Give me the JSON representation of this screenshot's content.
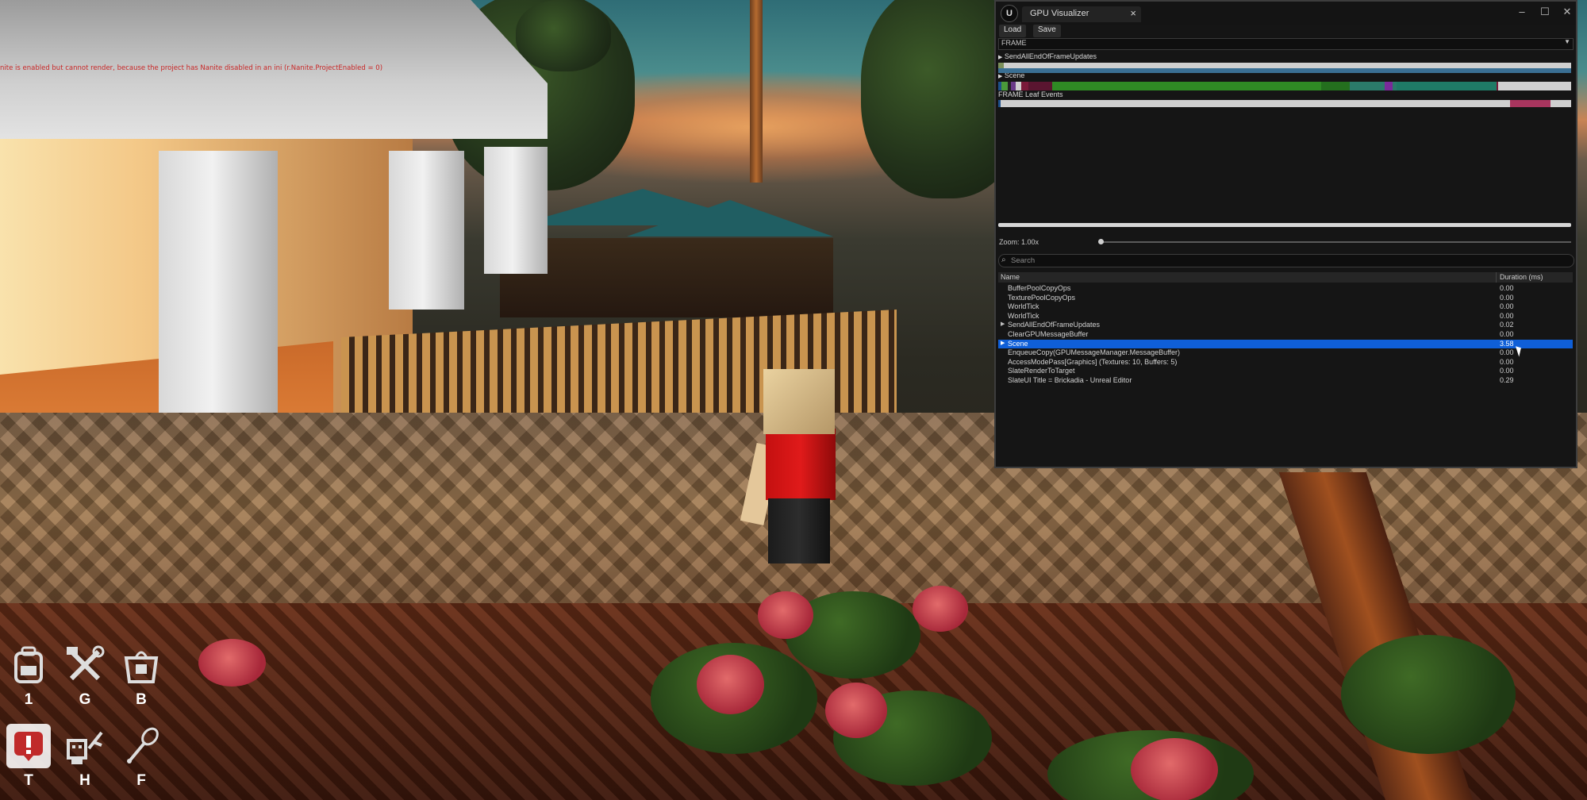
{
  "game": {
    "warning_text": "nite is enabled but cannot render, because the project has Nanite disabled in an ini (r.Nanite.ProjectEnabled = 0)",
    "hotbar": [
      {
        "icon": "backpack-icon",
        "key": "1"
      },
      {
        "icon": "hammer-wrench-icon",
        "key": "G"
      },
      {
        "icon": "brick-bag-icon",
        "key": "B"
      },
      {
        "icon": "alert-icon",
        "key": "T",
        "selected": true
      },
      {
        "icon": "build-worker-icon",
        "key": "H"
      },
      {
        "icon": "pen-icon",
        "key": "F"
      }
    ]
  },
  "window": {
    "tab_title": "GPU Visualizer",
    "toolbar": {
      "load": "Load",
      "save": "Save"
    },
    "frame_selector": "FRAME",
    "timeline": {
      "rows": [
        {
          "label": "SendAllEndOfFrameUpdates",
          "expandable": true
        },
        {
          "label": "Scene",
          "expandable": true
        },
        {
          "label": "FRAME Leaf Events",
          "expandable": false
        }
      ]
    },
    "zoom_label": "Zoom: 1.00x",
    "search_placeholder": "Search",
    "columns": {
      "name": "Name",
      "duration": "Duration (ms)"
    },
    "events": [
      {
        "name": "BufferPoolCopyOps",
        "duration": "0.00",
        "expandable": false
      },
      {
        "name": "TexturePoolCopyOps",
        "duration": "0.00",
        "expandable": false
      },
      {
        "name": "WorldTick",
        "duration": "0.00",
        "expandable": false
      },
      {
        "name": "WorldTick",
        "duration": "0.00",
        "expandable": false
      },
      {
        "name": "SendAllEndOfFrameUpdates",
        "duration": "0.02",
        "expandable": true
      },
      {
        "name": "ClearGPUMessageBuffer",
        "duration": "0.00",
        "expandable": false
      },
      {
        "name": "Scene",
        "duration": "3.58",
        "expandable": true,
        "selected": true
      },
      {
        "name": "EnqueueCopy(GPUMessageManager.MessageBuffer)",
        "duration": "0.00",
        "expandable": false
      },
      {
        "name": "AccessModePass[Graphics] (Textures: 10, Buffers: 5)",
        "duration": "0.00",
        "expandable": false
      },
      {
        "name": "SlateRenderToTarget",
        "duration": "0.00",
        "expandable": false
      },
      {
        "name": "SlateUI Title = Brickadia - Unreal Editor",
        "duration": "0.29",
        "expandable": false
      }
    ],
    "colors": {
      "selection": "#0f5fd8",
      "warning": "#c82626"
    }
  }
}
